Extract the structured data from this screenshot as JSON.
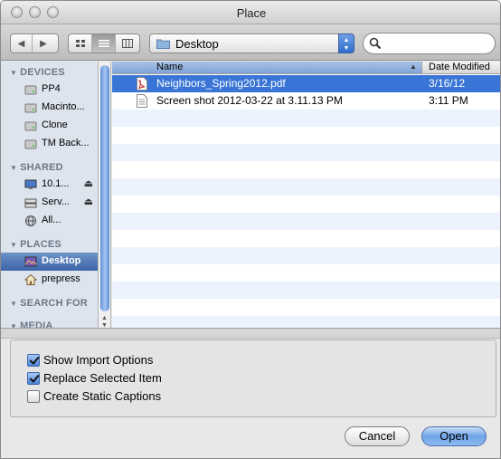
{
  "window": {
    "title": "Place"
  },
  "toolbar": {
    "location": "Desktop",
    "search_placeholder": ""
  },
  "sidebar": {
    "sections": [
      {
        "title": "DEVICES",
        "items": [
          "PP4",
          "Macinto...",
          "Clone",
          "TM Back..."
        ]
      },
      {
        "title": "SHARED",
        "items": [
          "10.1...",
          "Serv...",
          "All..."
        ]
      },
      {
        "title": "PLACES",
        "items": [
          "Desktop",
          "prepress"
        ]
      },
      {
        "title": "SEARCH FOR",
        "items": []
      },
      {
        "title": "MEDIA",
        "items": []
      }
    ],
    "selected": "Desktop"
  },
  "file_list": {
    "columns": {
      "name": "Name",
      "date": "Date Modified"
    },
    "rows": [
      {
        "name": "Neighbors_Spring2012.pdf",
        "date": "3/16/12",
        "icon": "pdf-icon",
        "selected": true
      },
      {
        "name": "Screen shot 2012-03-22 at 3.11.13 PM",
        "date": "3:11 PM",
        "icon": "document-icon",
        "selected": false
      }
    ]
  },
  "options": [
    {
      "label": "Show Import Options",
      "checked": true
    },
    {
      "label": "Replace Selected Item",
      "checked": true
    },
    {
      "label": "Create Static Captions",
      "checked": false
    }
  ],
  "buttons": {
    "cancel": "Cancel",
    "open": "Open"
  },
  "colors": {
    "selection": "#3875d7",
    "sidebar": "#dde4ee",
    "stripe": "#edf3fe"
  }
}
